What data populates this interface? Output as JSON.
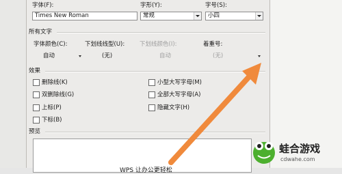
{
  "font_section": {
    "font_label": "字体(F):",
    "font_value": "Times New Roman",
    "style_label": "字形(Y):",
    "style_value": "常规",
    "size_label": "字号(S):",
    "size_value": "小四"
  },
  "all_text": {
    "title": "所有文字",
    "font_color_label": "字体颜色(C):",
    "font_color_value": "自动",
    "underline_label": "下划线线型(U):",
    "underline_value": "(无)",
    "underline_color_label": "下划线颜色(I):",
    "underline_color_value": "自动",
    "emphasis_label": "着重号:",
    "emphasis_value": "(无)"
  },
  "effects": {
    "title": "效果",
    "left": [
      "删除线(K)",
      "双删除线(G)",
      "上标(P)",
      "下标(B)"
    ],
    "right": [
      "小型大写字母(M)",
      "全部大写字母(A)",
      "隐藏文字(H)"
    ]
  },
  "preview": {
    "title": "预览",
    "sample_text": "WPS 让办公更轻松"
  },
  "watermark": {
    "name": "蛙合游戏",
    "url": "cdwahe.com"
  },
  "colors": {
    "arrow": "#f08a3c",
    "logo_green": "#4caf2e"
  }
}
